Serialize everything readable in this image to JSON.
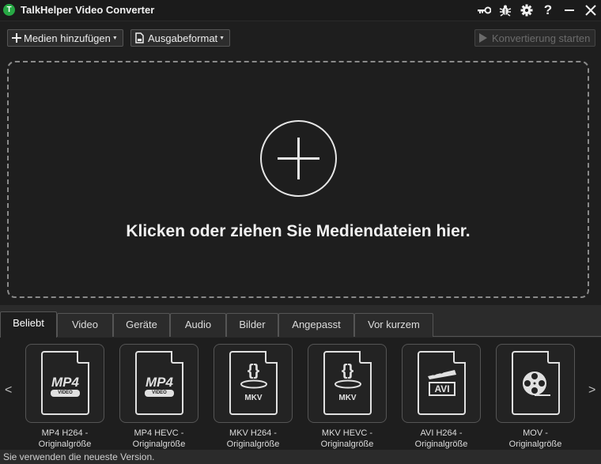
{
  "app": {
    "logo_letter": "T",
    "title": "TalkHelper Video Converter"
  },
  "titlebar_icons": [
    "key-icon",
    "bug-icon",
    "gear-icon",
    "help-icon",
    "minimize-icon",
    "close-icon"
  ],
  "toolbar": {
    "add_media": "Medien hinzufügen",
    "output_format": "Ausgabeformat",
    "start_conversion": "Konvertierung starten"
  },
  "dropzone": {
    "text": "Klicken oder ziehen Sie Mediendateien hier."
  },
  "tabs": [
    "Beliebt",
    "Video",
    "Geräte",
    "Audio",
    "Bilder",
    "Angepasst",
    "Vor kurzem"
  ],
  "active_tab": "Beliebt",
  "presets": [
    {
      "icon_text": "MP4",
      "icon_sub": "VIDEO",
      "line1": "MP4 H264 -",
      "line2": "Originalgröße"
    },
    {
      "icon_text": "MP4",
      "icon_sub": "VIDEO",
      "line1": "MP4 HEVC -",
      "line2": "Originalgröße"
    },
    {
      "icon_text": "MKV",
      "line1": "MKV H264 -",
      "line2": "Originalgröße"
    },
    {
      "icon_text": "MKV",
      "line1": "MKV HEVC -",
      "line2": "Originalgröße"
    },
    {
      "icon_text": "AVI",
      "line1": "AVI H264 -",
      "line2": "Originalgröße"
    },
    {
      "line1": "MOV -",
      "line2": "Originalgröße"
    }
  ],
  "nav": {
    "prev": "<",
    "next": ">"
  },
  "status": "Sie verwenden die neueste Version.",
  "colors": {
    "background": "#1e1e1e",
    "logo_green": "#27a844",
    "disabled_text": "#6b6b6b"
  }
}
